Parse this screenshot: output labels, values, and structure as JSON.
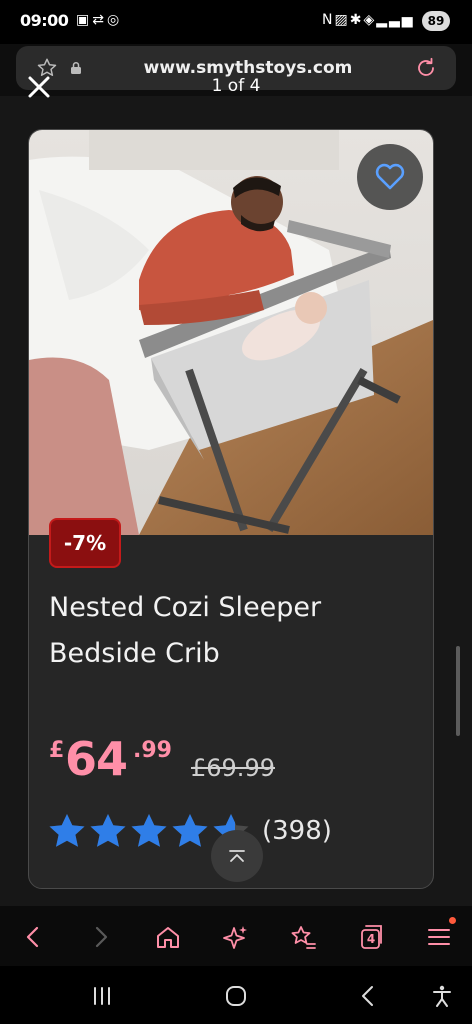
{
  "status_bar": {
    "time": "09:00",
    "left_icons": [
      "screenshot-icon",
      "car-icon",
      "hotspot-icon"
    ],
    "right_icons": [
      "nfc-icon",
      "nfc-alt-icon",
      "settings-icon",
      "wifi-icon",
      "signal-icon"
    ],
    "battery": "89"
  },
  "browser": {
    "url": "www.smythstoys.com",
    "icons": [
      "star-outline-icon",
      "lock-icon",
      "reload-icon"
    ]
  },
  "viewer": {
    "counter": "1 of 4",
    "close_icon": "close-icon"
  },
  "product": {
    "badge": "-7%",
    "title": "Nested Cozi Sleeper Bedside Crib",
    "price_currency": "£",
    "price_integer": "64",
    "price_decimal": ".99",
    "was_price": "£69.99",
    "rating": 4.6,
    "rating_max": 5,
    "review_count": "(398)",
    "wishlist_icon": "heart-icon",
    "image": "photo-man-baby-bedside-crib"
  },
  "toolbar": {
    "items": [
      "back-icon",
      "forward-icon",
      "home-icon",
      "ai-sparkle-icon",
      "bookmarks-icon",
      "tabs-icon",
      "menu-icon"
    ],
    "tab_count": "4"
  },
  "system_nav": {
    "items": [
      "recents-icon",
      "home-circle-icon",
      "back-nav-icon",
      "accessibility-icon"
    ]
  },
  "colors": {
    "accent_price": "#ff8fa8",
    "badge_bg": "#8b0f10",
    "star": "#2f7ee8",
    "heart": "#5aa0ff"
  }
}
